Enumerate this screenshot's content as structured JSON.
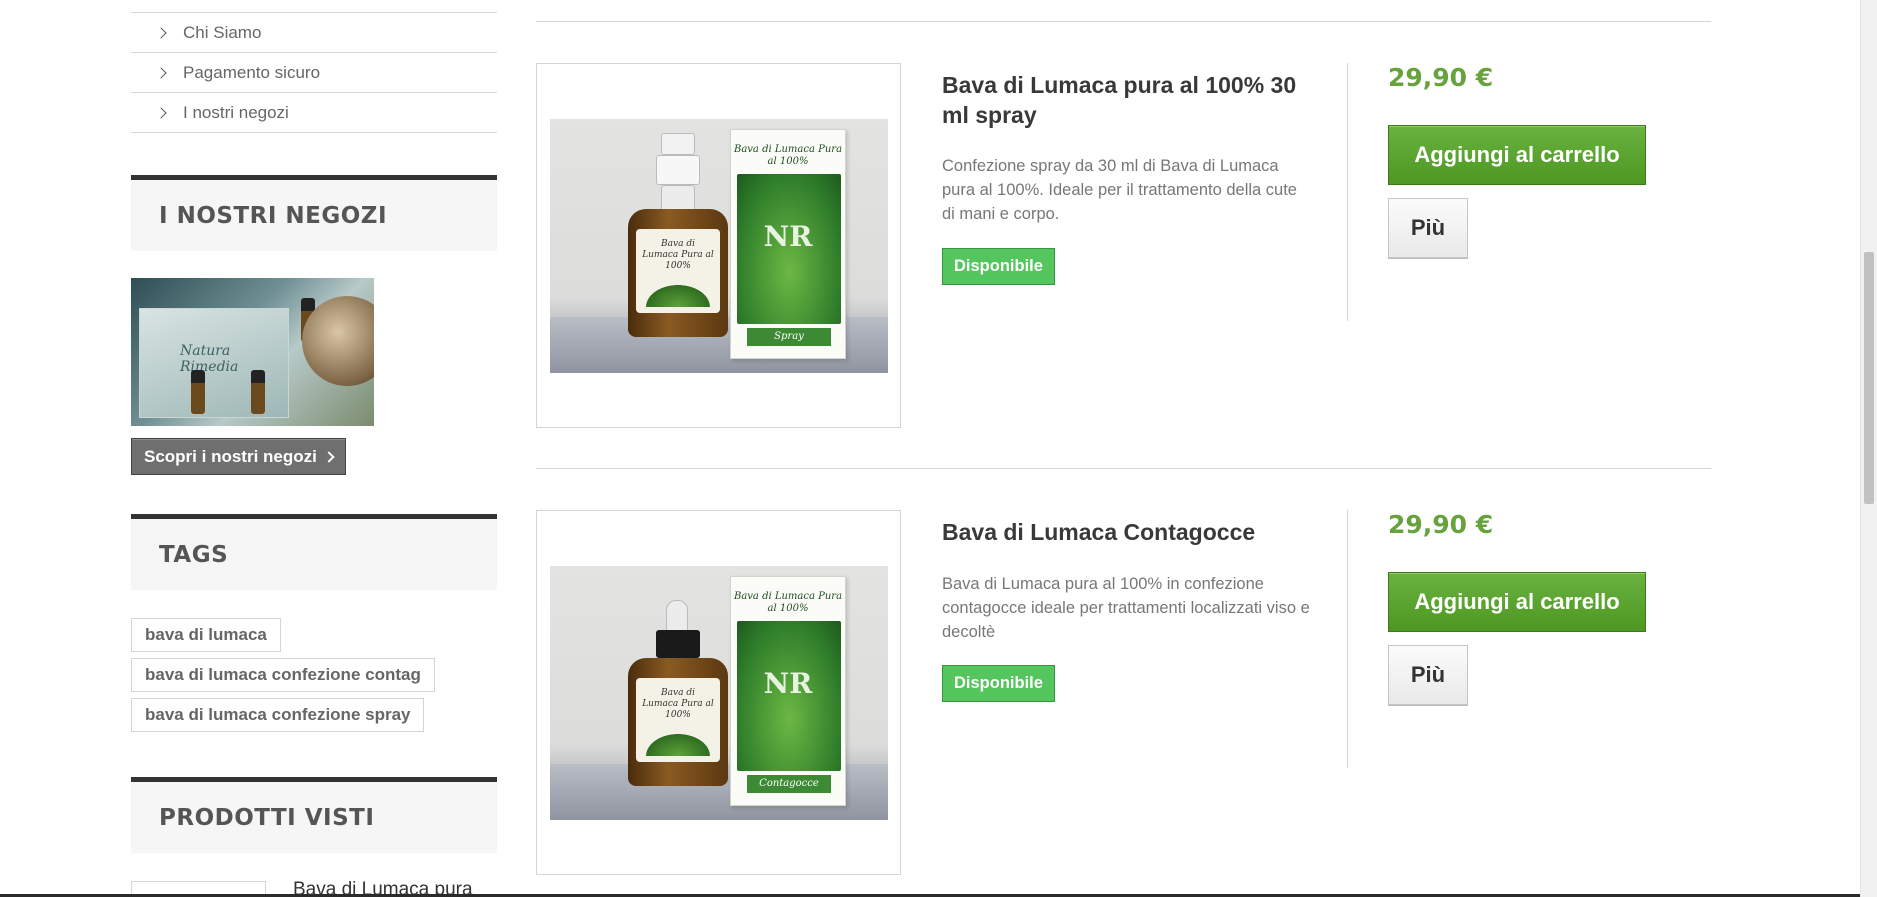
{
  "sidebar": {
    "nav_items": [
      "Chi Siamo",
      "Pagamento sicuro",
      "I nostri negozi"
    ],
    "stores_block": {
      "title": "I NOSTRI NEGOZI",
      "image_caption": "Natura Rimedia",
      "button_label": "Scopri i nostri negozi"
    },
    "tags_block": {
      "title": "TAGS",
      "tags": [
        "bava di lumaca",
        "bava di lumaca confezione contag",
        "bava di lumaca confezione spray"
      ]
    },
    "viewed_block": {
      "title": "PRODOTTI VISTI",
      "first_item_name": "Bava di Lumaca pura"
    }
  },
  "products": [
    {
      "name": "Bava di Lumaca pura al 100% 30 ml spray",
      "description": "Confezione spray da 30 ml di Bava di Lumaca pura al 100%. Ideale per il trattamento della cute di mani e corpo.",
      "availability": "Disponibile",
      "price": "29,90 €",
      "cart_label": "Aggiungi al carrello",
      "more_label": "Più",
      "image": {
        "box_title": "Bava di Lumaca Pura al 100%",
        "box_logo": "NR",
        "box_footer": "Spray",
        "bottle_label": "Bava di Lumaca Pura al 100%"
      }
    },
    {
      "name": "Bava di Lumaca Contagocce",
      "description": "Bava di Lumaca pura al 100% in confezione contagocce ideale per trattamenti localizzati viso e decoltè",
      "availability": "Disponibile",
      "price": "29,90 €",
      "cart_label": "Aggiungi al carrello",
      "more_label": "Più",
      "image": {
        "box_title": "Bava di Lumaca Pura al 100%",
        "box_logo": "NR",
        "box_footer": "Contagocce",
        "bottle_label": "Bava di Lumaca Pura al 100%"
      }
    }
  ],
  "colors": {
    "price": "#67a33d",
    "cart_button": "#5aa52f",
    "available_badge": "#55c65e",
    "block_title_bg": "#f6f6f6"
  },
  "icons": {
    "nav_chevron": "chevron-right-icon",
    "stores_arrow": "chevron-right-icon"
  }
}
